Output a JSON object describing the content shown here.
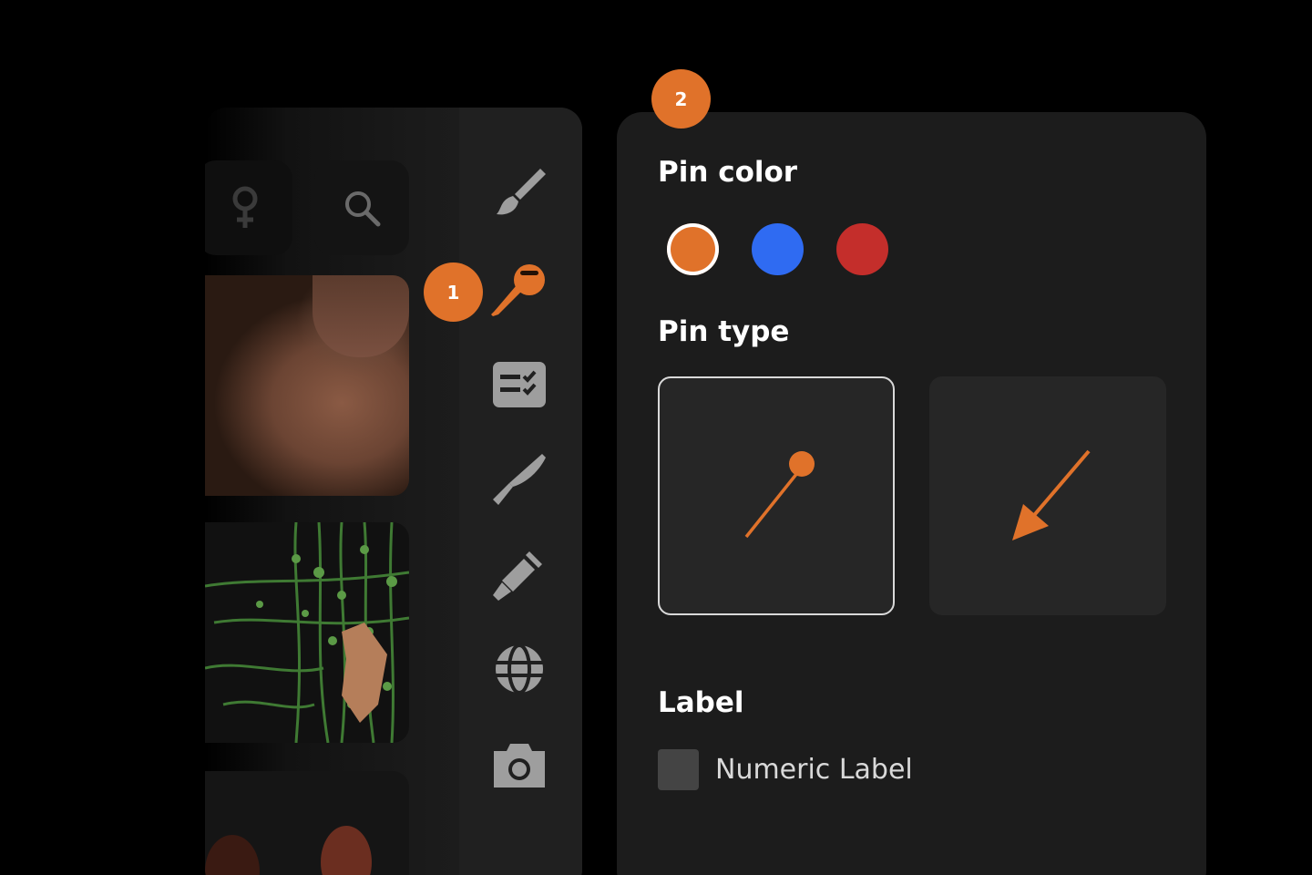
{
  "colors": {
    "accent": "#e0722a",
    "blue": "#2f6bf2",
    "red": "#c42e2b"
  },
  "badges": {
    "one": "1",
    "two": "2"
  },
  "pin_color": {
    "title": "Pin color",
    "swatches": [
      {
        "name": "orange",
        "color": "#e0722a",
        "selected": true
      },
      {
        "name": "blue",
        "color": "#2f6bf2",
        "selected": false
      },
      {
        "name": "red",
        "color": "#c42e2b",
        "selected": false
      }
    ]
  },
  "pin_type": {
    "title": "Pin type",
    "options": [
      {
        "name": "pin",
        "icon": "pin-icon",
        "selected": true
      },
      {
        "name": "arrow",
        "icon": "arrow-icon",
        "selected": false
      }
    ]
  },
  "label_section": {
    "title": "Label",
    "checkbox_label": "Numeric Label",
    "checked": false
  },
  "tools": [
    "brush-icon",
    "pin-icon",
    "checklist-icon",
    "scalpel-icon",
    "syringe-icon",
    "globe-icon",
    "camera-icon"
  ],
  "left_buttons": [
    "female-icon",
    "search-icon"
  ]
}
